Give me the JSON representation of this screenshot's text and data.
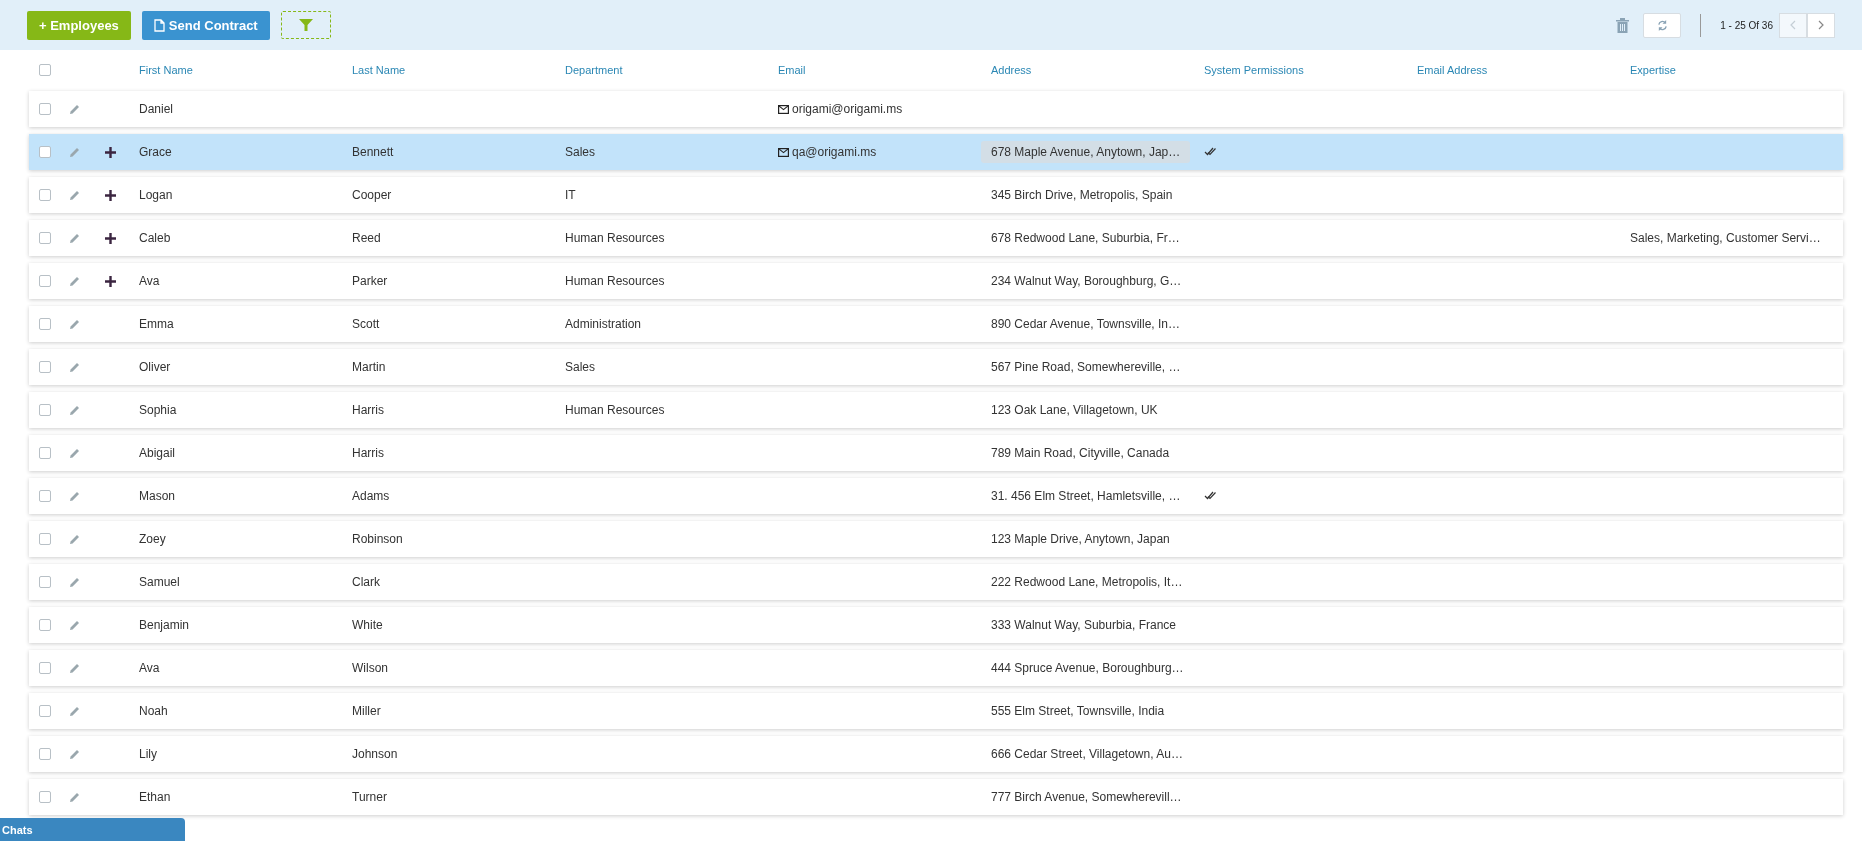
{
  "toolbar": {
    "add_button": "+ Employees",
    "contract_button": "Send Contract",
    "pagination": {
      "range": "1 - 25 Of 36",
      "prev_disabled": true,
      "next_disabled": false
    }
  },
  "table": {
    "select_all_checked": false,
    "columns": [
      "First Name",
      "Last Name",
      "Department",
      "Email",
      "Address",
      "System Permissions",
      "Email Address",
      "Expertise"
    ],
    "rows": [
      {
        "first": "Daniel",
        "email": "origami@origami.ms",
        "expandable": false,
        "selected": false,
        "checked": false,
        "permission": false
      },
      {
        "first": "Grace",
        "last": "Bennett",
        "department": "Sales",
        "email": "qa@origami.ms",
        "address": "678 Maple Avenue, Anytown, Jap…",
        "expandable": true,
        "selected": true,
        "checked": false,
        "permission": true,
        "address_focused": true
      },
      {
        "first": "Logan",
        "last": "Cooper",
        "department": "IT",
        "address": "345 Birch Drive, Metropolis, Spain",
        "expandable": true,
        "selected": false,
        "checked": false,
        "permission": false,
        "address_focused": false
      },
      {
        "first": "Caleb",
        "last": "Reed",
        "department": "Human Resources",
        "address": "678 Redwood Lane, Suburbia, Fr…",
        "expertise": "Sales, Marketing, Customer Servi…",
        "expandable": true,
        "selected": false,
        "checked": false,
        "permission": false,
        "address_focused": false
      },
      {
        "first": "Ava",
        "last": "Parker",
        "department": "Human Resources",
        "address": "234 Walnut Way, Boroughburg, G…",
        "expandable": true,
        "selected": false,
        "checked": false,
        "permission": false,
        "address_focused": false
      },
      {
        "first": "Emma",
        "last": "Scott",
        "department": "Administration",
        "address": "890 Cedar Avenue, Townsville, In…",
        "expandable": false,
        "selected": false,
        "checked": false,
        "permission": false,
        "address_focused": false
      },
      {
        "first": "Oliver",
        "last": "Martin",
        "department": "Sales",
        "address": "567 Pine Road, Somewhereville, …",
        "expandable": false,
        "selected": false,
        "checked": false,
        "permission": false,
        "address_focused": false
      },
      {
        "first": "Sophia",
        "last": "Harris",
        "department": "Human Resources",
        "address": "123 Oak Lane, Villagetown, UK",
        "expandable": false,
        "selected": false,
        "checked": false,
        "permission": false,
        "address_focused": false
      },
      {
        "first": "Abigail",
        "last": "Harris",
        "address": "789 Main Road, Cityville, Canada",
        "expandable": false,
        "selected": false,
        "checked": false,
        "permission": false,
        "address_focused": false
      },
      {
        "first": "Mason",
        "last": "Adams",
        "address": "31. 456 Elm Street, Hamletsville, …",
        "expandable": false,
        "selected": false,
        "checked": false,
        "permission": true,
        "address_focused": false
      },
      {
        "first": "Zoey",
        "last": "Robinson",
        "address": "123 Maple Drive, Anytown, Japan",
        "expandable": false,
        "selected": false,
        "checked": false,
        "permission": false,
        "address_focused": false
      },
      {
        "first": "Samuel",
        "last": "Clark",
        "address": "222 Redwood Lane, Metropolis, It…",
        "expandable": false,
        "selected": false,
        "checked": false,
        "permission": false,
        "address_focused": false
      },
      {
        "first": "Benjamin",
        "last": "White",
        "address": "333 Walnut Way, Suburbia, France",
        "expandable": false,
        "selected": false,
        "checked": false,
        "permission": false,
        "address_focused": false
      },
      {
        "first": "Ava",
        "last": "Wilson",
        "address": "444 Spruce Avenue, Boroughburg…",
        "expandable": false,
        "selected": false,
        "checked": false,
        "permission": false,
        "address_focused": false
      },
      {
        "first": "Noah",
        "last": "Miller",
        "address": "555 Elm Street, Townsville, India",
        "expandable": false,
        "selected": false,
        "checked": false,
        "permission": false,
        "address_focused": false
      },
      {
        "first": "Lily",
        "last": "Johnson",
        "address": "666 Cedar Street, Villagetown, Au…",
        "expandable": false,
        "selected": false,
        "checked": false,
        "permission": false,
        "address_focused": false
      },
      {
        "first": "Ethan",
        "last": "Turner",
        "address": "777 Birch Avenue, Somewherevill…",
        "expandable": false,
        "selected": false,
        "checked": false,
        "permission": false,
        "address_focused": false
      }
    ]
  },
  "chat_tab": "Chats"
}
